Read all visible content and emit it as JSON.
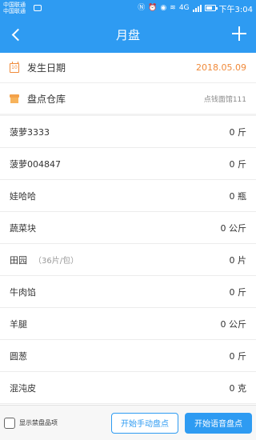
{
  "status_bar": {
    "carrier_1": "中国联通",
    "carrier_2": "中国联通",
    "network": "4G",
    "time": "下午3:04"
  },
  "header": {
    "title": "月盘"
  },
  "info": {
    "date_label": "发生日期",
    "date_value": "2018.05.09",
    "date_icon_text": "10",
    "store_label": "盘点仓库",
    "store_value": "点钱面馆111"
  },
  "items": [
    {
      "name": "菠萝3333",
      "spec": "",
      "qty": "0 斤"
    },
    {
      "name": "菠萝004847",
      "spec": "",
      "qty": "0 斤"
    },
    {
      "name": "娃哈哈",
      "spec": "",
      "qty": "0 瓶"
    },
    {
      "name": "蔬菜块",
      "spec": "",
      "qty": "0 公斤"
    },
    {
      "name": "田园",
      "spec": "（36片/包）",
      "qty": "0 片"
    },
    {
      "name": "牛肉馅",
      "spec": "",
      "qty": "0 斤"
    },
    {
      "name": "羊腿",
      "spec": "",
      "qty": "0 公斤"
    },
    {
      "name": "圆葱",
      "spec": "",
      "qty": "0 斤"
    },
    {
      "name": "混沌皮",
      "spec": "",
      "qty": "0 克"
    }
  ],
  "footer": {
    "checkbox_label": "显示禁盘品项",
    "manual_button": "开始手动盘点",
    "voice_button": "开始语音盘点"
  },
  "colors": {
    "primary": "#2e9bf2",
    "accent": "#f08a3a"
  }
}
